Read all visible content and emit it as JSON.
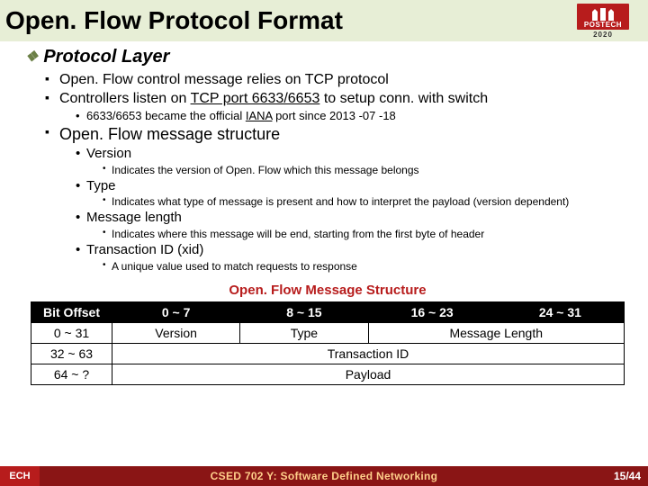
{
  "title": "Open. Flow Protocol Format",
  "logo": {
    "name": "POSTECH",
    "year": "2020"
  },
  "section": "Protocol Layer",
  "bullets": {
    "b1": "Open. Flow control message relies on TCP protocol",
    "b2a": "Controllers listen on ",
    "b2b": "TCP port 6633/6653",
    "b2c": " to setup conn. with switch",
    "b2_1a": "6633/6653 became the official ",
    "b2_1b": "IANA",
    "b2_1c": " port since 2013 -07 -18",
    "b3": "Open. Flow message structure",
    "v": "Version",
    "v1": "Indicates the version of Open. Flow which this message belongs",
    "t": "Type",
    "t1": "Indicates what type of message is present and how to interpret the payload (version dependent)",
    "m": "Message length",
    "m1": "Indicates where this message will be end, starting from the first byte of header",
    "x": "Transaction ID (xid)",
    "x1": "A unique value used to match requests to response"
  },
  "table": {
    "title": "Open. Flow Message Structure",
    "head": [
      "Bit Offset",
      "0 ~ 7",
      "8 ~ 15",
      "16 ~ 23",
      "24 ~ 31"
    ],
    "rows": {
      "r1": {
        "off": "0 ~ 31",
        "c1": "Version",
        "c2": "Type",
        "c3": "Message Length"
      },
      "r2": {
        "off": "32 ~ 63",
        "span": "Transaction ID"
      },
      "r3": {
        "off": "64 ~ ?",
        "span": "Payload"
      }
    }
  },
  "footer": {
    "left": "ECH",
    "center": "CSED 702 Y: Software Defined Networking",
    "right": "15/44"
  }
}
